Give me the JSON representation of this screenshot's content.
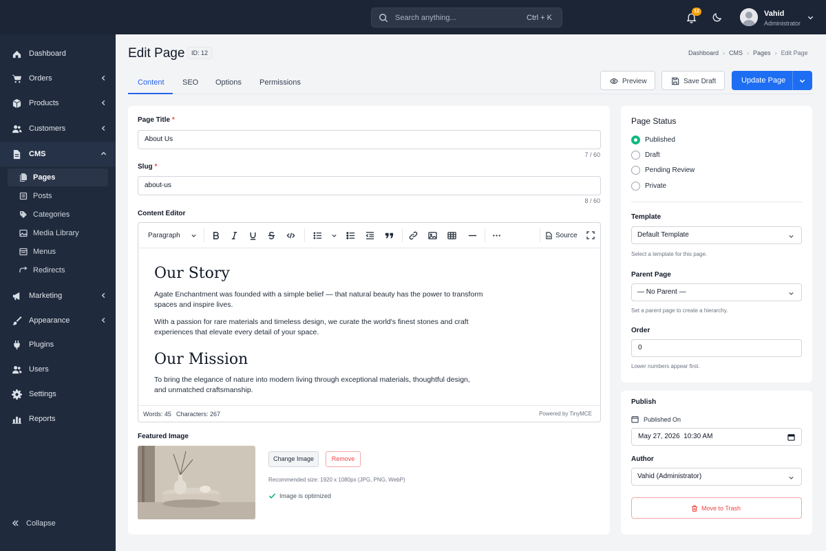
{
  "topbar": {
    "search_placeholder": "Search anything...",
    "search_shortcut": "Ctrl + K",
    "notification_count": "12",
    "user_name": "Vahid",
    "user_role": "Administrator"
  },
  "sidebar": {
    "items": [
      {
        "label": "Dashboard",
        "icon": "dashboard-icon"
      },
      {
        "label": "Orders",
        "icon": "cart-icon"
      },
      {
        "label": "Products",
        "icon": "box-icon"
      },
      {
        "label": "Customers",
        "icon": "users-icon"
      },
      {
        "label": "CMS",
        "icon": "file-icon"
      },
      {
        "label": "Marketing",
        "icon": "megaphone-icon"
      },
      {
        "label": "Appearance",
        "icon": "brush-icon"
      },
      {
        "label": "Plugins",
        "icon": "plug-icon"
      },
      {
        "label": "Users",
        "icon": "user-group-icon"
      },
      {
        "label": "Settings",
        "icon": "gear-icon"
      },
      {
        "label": "Reports",
        "icon": "chart-icon"
      }
    ],
    "cms_sub": [
      {
        "label": "Pages"
      },
      {
        "label": "Posts"
      },
      {
        "label": "Categories"
      },
      {
        "label": "Media Library"
      },
      {
        "label": "Menus"
      },
      {
        "label": "Redirects"
      }
    ],
    "collapse_label": "Collapse"
  },
  "header": {
    "title": "Edit Page",
    "id_badge": "ID: 12",
    "breadcrumb": [
      "Dashboard",
      "CMS",
      "Pages",
      "Edit Page"
    ],
    "tabs": [
      "Content",
      "SEO",
      "Options",
      "Permissions"
    ],
    "preview_label": "Preview",
    "save_draft_label": "Save Draft",
    "update_label": "Update Page"
  },
  "form": {
    "page_title_label": "Page Title",
    "page_title_value": "About Us",
    "page_title_counter": "7 / 60",
    "slug_label": "Slug",
    "slug_value": "about-us",
    "slug_counter": "8 / 60",
    "required_mark": "*",
    "editor_label": "Content Editor",
    "block_format": "Paragraph",
    "source_label": "Source",
    "content": {
      "heading1": "Our Story",
      "para1": "Agate Enchantment was founded with a simple belief — that natural beauty has the power to transform spaces and inspire lives.",
      "para2": "With a passion for rare materials and timeless design, we curate the world's finest stones and craft experiences that elevate every detail of your space.",
      "heading2": "Our Mission",
      "para3": "To bring the elegance of nature into modern living through exceptional materials, thoughtful design, and unmatched craftsmanship."
    },
    "words": "Words: 45",
    "characters": "Characters: 267",
    "powered_by": "Powered by TinyMCE",
    "featured_label": "Featured Image",
    "change_image_label": "Change Image",
    "remove_label": "Remove",
    "recommended": "Recommended size: 1920 x 1080px (JPG, PNG, WebP)",
    "optimized": "Image is optimized"
  },
  "status_panel": {
    "title": "Page Status",
    "options": [
      "Published",
      "Draft",
      "Pending Review",
      "Private"
    ],
    "selected": "Published",
    "template_label": "Template",
    "template_value": "Default Template",
    "template_hint": "Select a template for this page.",
    "parent_label": "Parent Page",
    "parent_value": "— No Parent —",
    "parent_hint": "Set a parent page to create a hierarchy.",
    "order_label": "Order",
    "order_value": "0",
    "order_hint": "Lower numbers appear first."
  },
  "publish_panel": {
    "title": "Publish",
    "published_on_label": "Published On",
    "published_on_value": "May 27, 2026  10:30 AM",
    "author_label": "Author",
    "author_value": "Vahid (Administrator)",
    "trash_label": "Move to Trash"
  },
  "colors": {
    "primary": "#1d6ef2",
    "sidebar": "#1f2a3c",
    "topbar": "#1b2536",
    "success": "#10b981",
    "danger": "#ef4444"
  }
}
